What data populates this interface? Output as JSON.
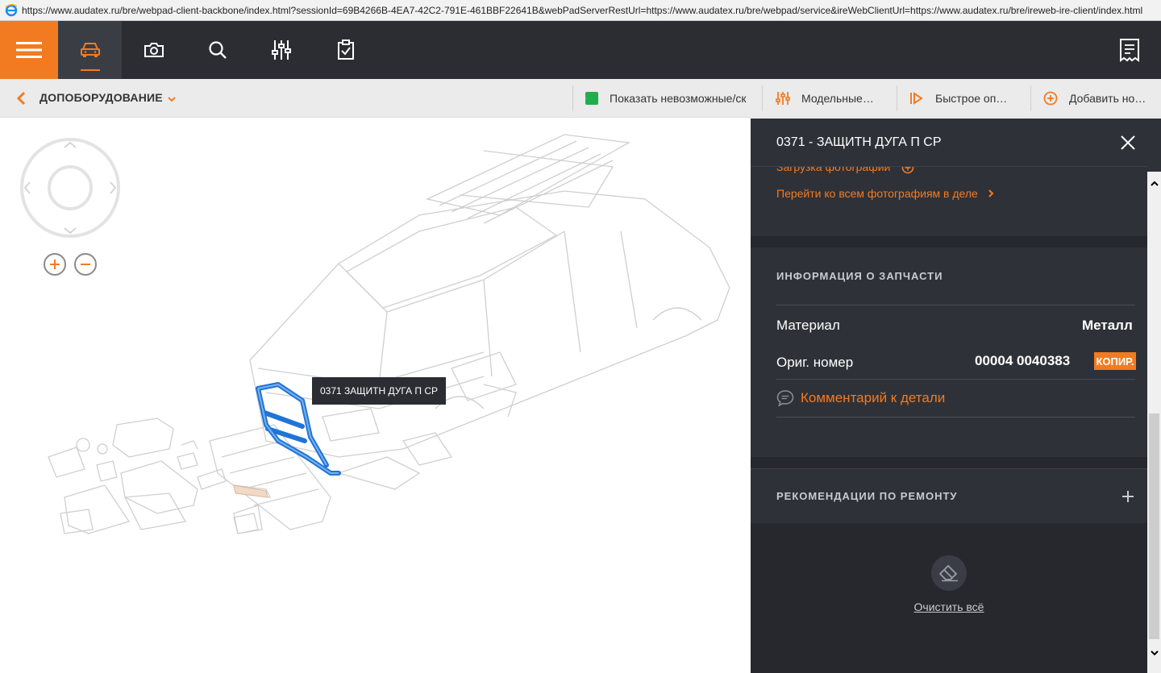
{
  "browser": {
    "url": "https://www.audatex.ru/bre/webpad-client-backbone/index.html?sessionId=69B4266B-4EA7-42C2-791E-461BBF22641B&webPadServerRestUrl=https://www.audatex.ru/bre/webpad/service&ireWebClientUrl=https://www.audatex.ru/bre/ireweb-ire-client/index.html"
  },
  "topnav": {
    "icons": [
      "menu-icon",
      "car-icon",
      "camera-icon",
      "search-icon",
      "sliders-icon",
      "clipboard-check-icon",
      "receipt-icon"
    ],
    "accent": "#f27b21"
  },
  "subbar": {
    "section_title": "ДОПОБОРУДОВАНИЕ",
    "show_impossible_label": "Показать невозможные/ск",
    "model_label": "Модельные…",
    "quick_label": "Быстрое оп…",
    "add_new_label": "Добавить но…"
  },
  "viewer": {
    "tooltip": "0371 ЗАЩИТН ДУГА П СР"
  },
  "panel": {
    "title": "0371 - ЗАЩИТН ДУГА П СР",
    "photo_upload": "Загрузка фотографии",
    "photo_link": "Перейти ко всем фотографиям в деле",
    "info_title": "ИНФОРМАЦИЯ О ЗАПЧАСТИ",
    "material_label": "Материал",
    "material_value": "Металл",
    "orig_label": "Ориг. номер",
    "orig_value": "00004 0040383",
    "copy_label": "КОПИР.",
    "comment_label": "Комментарий к детали",
    "repair_title": "РЕКОМЕНДАЦИИ ПО РЕМОНТУ",
    "clear_all": "Очистить всё"
  }
}
